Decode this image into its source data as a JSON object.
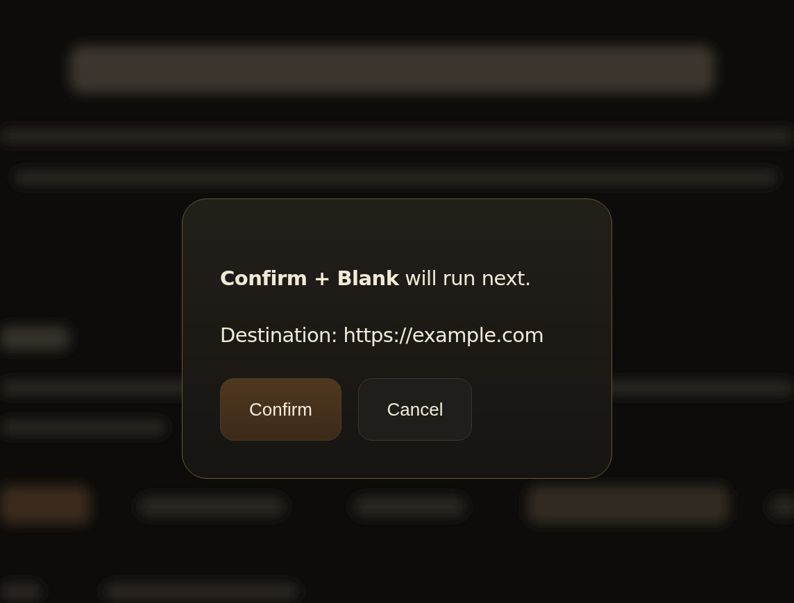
{
  "dialog": {
    "message": "**Confirm + Blank** will run next.",
    "destination": "Destination: https://example.com",
    "buttons": [
      {
        "label": "Confirm",
        "kind": "primary"
      },
      {
        "label": "Cancel",
        "kind": "secondary"
      }
    ]
  }
}
